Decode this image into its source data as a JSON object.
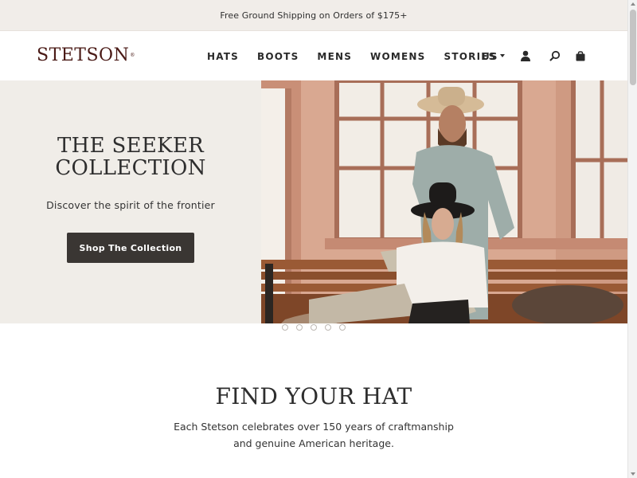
{
  "announcement": "Free Ground Shipping on Orders of $175+",
  "header": {
    "logo": "STETSON",
    "nav": [
      "HATS",
      "BOOTS",
      "MENS",
      "WOMENS",
      "STORIES"
    ],
    "locale": "US",
    "icons": [
      "account-icon",
      "search-icon",
      "bag-icon"
    ]
  },
  "hero": {
    "title_line1": "THE SEEKER",
    "title_line2": "COLLECTION",
    "subtitle": "Discover the spirit of the frontier",
    "cta": "Shop The Collection",
    "slides": 5,
    "active_slide": 1
  },
  "section": {
    "title": "FIND YOUR HAT",
    "text_line1": "Each Stetson celebrates over 150 years of craftmanship",
    "text_line2": "and genuine American heritage."
  },
  "colors": {
    "brand": "#4a1a16",
    "announce_bg": "#f1ede9",
    "hero_bg": "#f0ede8",
    "button_bg": "#3a3633"
  }
}
